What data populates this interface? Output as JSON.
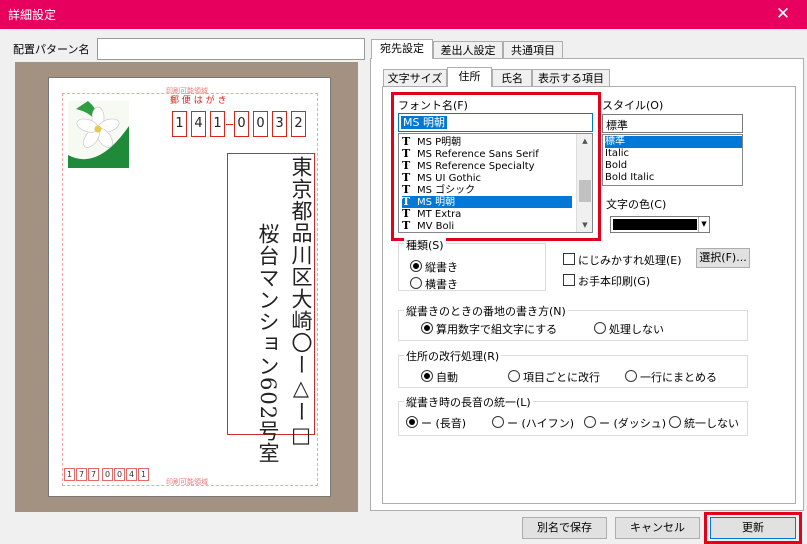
{
  "window": {
    "title": "詳細設定",
    "close_glyph": "✕"
  },
  "pattern": {
    "label": "配置パターン名",
    "value": ""
  },
  "card": {
    "header_small": "印刷可能領域",
    "postcard_title": "郵 便 は が き",
    "recipient_zip": [
      "1",
      "4",
      "1",
      "0",
      "0",
      "3",
      "2"
    ],
    "address_line1": "東京都品川区大崎〇ー△ー□",
    "address_line2": "桜台マンション602号室",
    "sender_zip": [
      "1",
      "7",
      "7",
      "0",
      "0",
      "4",
      "1"
    ],
    "footer_small": "印刷可能領域"
  },
  "main_tabs": [
    {
      "label": "宛先設定",
      "active": true
    },
    {
      "label": "差出人設定",
      "active": false
    },
    {
      "label": "共通項目",
      "active": false
    }
  ],
  "sub_tabs": [
    {
      "label": "文字サイズ",
      "active": false
    },
    {
      "label": "住所",
      "active": true
    },
    {
      "label": "氏名",
      "active": false
    },
    {
      "label": "表示する項目",
      "active": false
    }
  ],
  "font": {
    "label": "フォント名(F)",
    "value": "MS 明朝",
    "list": [
      "MS P明朝",
      "MS Reference Sans Serif",
      "MS Reference Specialty",
      "MS UI Gothic",
      "MS ゴシック",
      "MS 明朝",
      "MT Extra",
      "MV Boli"
    ],
    "selected_index": 5
  },
  "style": {
    "label": "スタイル(O)",
    "value": "標準",
    "list": [
      "標準",
      "Italic",
      "Bold",
      "Bold Italic"
    ],
    "selected_index": 0
  },
  "color": {
    "label": "文字の色(C)",
    "value": "#000000"
  },
  "orientation": {
    "title": "種類(S)",
    "options": [
      "縦書き",
      "横書き"
    ],
    "selected": 0
  },
  "blur": {
    "label": "にじみかすれ処理(E)",
    "checked": false,
    "select_button": "選択(F)..."
  },
  "model_print": {
    "label": "お手本印刷(G)",
    "checked": false
  },
  "number_style": {
    "title": "縦書きのときの番地の書き方(N)",
    "options": [
      "算用数字で組文字にする",
      "処理しない"
    ],
    "selected": 0
  },
  "line_break": {
    "title": "住所の改行処理(R)",
    "options": [
      "自動",
      "項目ごとに改行",
      "一行にまとめる"
    ],
    "selected": 0
  },
  "long_vowel": {
    "title": "縦書き時の長音の統一(L)",
    "options": [
      "ー (長音)",
      "ー (ハイフン)",
      "ー (ダッシュ)",
      "統一しない"
    ],
    "selected": 0
  },
  "buttons": {
    "save_as": "別名で保存",
    "cancel": "キャンセル",
    "update": "更新"
  },
  "accent": {
    "titlebar": "#e8005f",
    "highlight": "#e2001a",
    "selection": "#0078d7"
  }
}
